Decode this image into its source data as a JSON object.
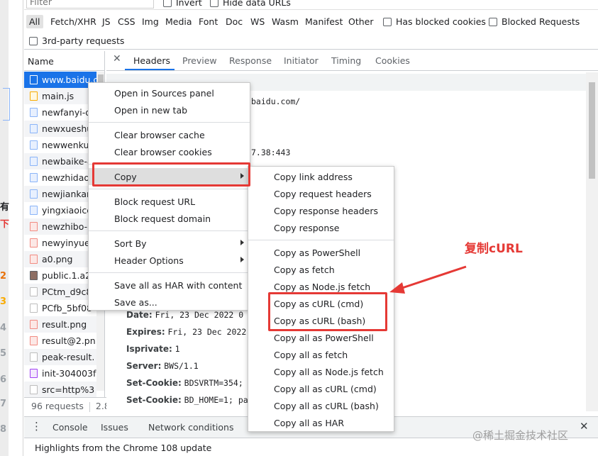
{
  "toolbar": {
    "filter_placeholder": "Filter",
    "invert_label": "Invert",
    "hide_data_urls_label": "Hide data URLs",
    "filters": [
      "All",
      "Fetch/XHR",
      "JS",
      "CSS",
      "Img",
      "Media",
      "Font",
      "Doc",
      "WS",
      "Wasm",
      "Manifest",
      "Other"
    ],
    "has_blocked_cookies_label": "Has blocked cookies",
    "blocked_requests_label": "Blocked Requests",
    "third_party_label": "3rd-party requests"
  },
  "left_strip": {
    "chars": [
      "有",
      "下",
      "2",
      "3",
      "4",
      "5",
      "6",
      "7",
      "8"
    ]
  },
  "list": {
    "header": "Name",
    "rows": [
      {
        "name": "www.baidu.com",
        "icon": "doc"
      },
      {
        "name": "main.js",
        "icon": "js"
      },
      {
        "name": "newfanyi-d",
        "icon": "img"
      },
      {
        "name": "newxueshu",
        "icon": "img"
      },
      {
        "name": "newwenku",
        "icon": "img"
      },
      {
        "name": "newbaike-8",
        "icon": "img"
      },
      {
        "name": "newzhidao",
        "icon": "img"
      },
      {
        "name": "newjiankar",
        "icon": "img"
      },
      {
        "name": "yingxiaoicc",
        "icon": "img"
      },
      {
        "name": "newzhibo-",
        "icon": "red"
      },
      {
        "name": "newyinyue",
        "icon": "red"
      },
      {
        "name": "a0.png",
        "icon": "red"
      },
      {
        "name": "public.1.a2",
        "icon": "png"
      },
      {
        "name": "PCtm_d9c8",
        "icon": "plain"
      },
      {
        "name": "PCfb_5bf08",
        "icon": "plain"
      },
      {
        "name": "result.png",
        "icon": "red"
      },
      {
        "name": "result@2.pn",
        "icon": "red"
      },
      {
        "name": "peak-result.",
        "icon": "plain"
      },
      {
        "name": "init-304003f",
        "icon": "purple"
      },
      {
        "name": "src=http%3",
        "icon": "plain"
      }
    ],
    "footer_requests": "96 requests",
    "footer_size": "2.8"
  },
  "detail": {
    "tabs": [
      "Headers",
      "Preview",
      "Response",
      "Initiator",
      "Timing",
      "Cookies"
    ],
    "active_tab": "Headers",
    "general_partial_url": "baidu.com/",
    "general_partial_addr": "7.38:443",
    "headers": [
      {
        "key": "Date:",
        "value": "Fri, 23 Dec 2022 0"
      },
      {
        "key": "Expires:",
        "value": "Fri, 23 Dec 2022"
      },
      {
        "key": "Isprivate:",
        "value": "1"
      },
      {
        "key": "Server:",
        "value": "BWS/1.1"
      },
      {
        "key": "Set-Cookie:",
        "value": "BDSVRTM=354;"
      },
      {
        "key": "Set-Cookie:",
        "value": "BD_HOME=1; pa"
      }
    ]
  },
  "context_menu": {
    "groups": [
      [
        "Open in Sources panel",
        "Open in new tab"
      ],
      [
        "Clear browser cache",
        "Clear browser cookies"
      ],
      [
        "Copy"
      ],
      [
        "Block request URL",
        "Block request domain"
      ],
      [
        "Sort By",
        "Header Options"
      ],
      [
        "Save all as HAR with content",
        "Save as..."
      ]
    ]
  },
  "copy_submenu": {
    "groups": [
      [
        "Copy link address",
        "Copy request headers",
        "Copy response headers",
        "Copy response"
      ],
      [
        "Copy as PowerShell",
        "Copy as fetch",
        "Copy as Node.js fetch",
        "Copy as cURL (cmd)",
        "Copy as cURL (bash)",
        "Copy all as PowerShell",
        "Copy all as fetch",
        "Copy all as Node.js fetch",
        "Copy all as cURL (cmd)",
        "Copy all as cURL (bash)",
        "Copy all as HAR"
      ]
    ]
  },
  "drawer": {
    "tabs": [
      "Console",
      "Issues",
      "Network conditions"
    ],
    "highlights": "Highlights from the Chrome 108 update"
  },
  "annotation": {
    "label": "复制cURL",
    "color": "#e53935"
  },
  "watermark": "@稀土掘金技术社区",
  "colors": {
    "accent": "#1a73e8",
    "annotation_red": "#e53935"
  }
}
